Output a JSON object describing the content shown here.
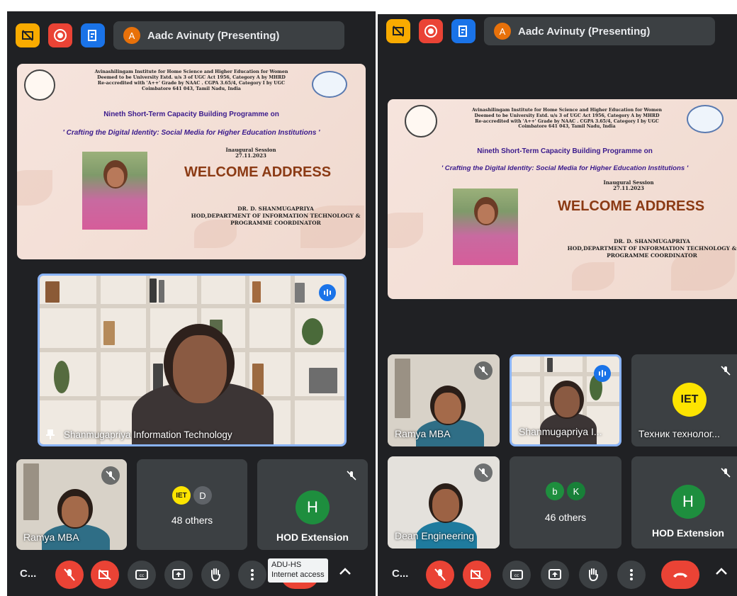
{
  "presenter": {
    "initial": "A",
    "name": "Aadc Avinuty (Presenting)"
  },
  "slide": {
    "institution": [
      "Avinashilingam Institute for Home Science and Higher Education for Women",
      "Deemed to be University Estd. u/s 3 of UGC Act 1956, Category A by MHRD",
      "Re-accredited with 'A++' Grade by NAAC . CGPA 3.65/4, Category I by UGC",
      "Coimbatore 641 043, Tamil Nadu, India"
    ],
    "programme": "Nineth Short-Term Capacity Building Programme on",
    "theme": "' Crafting the Digital Identity: Social Media for Higher Education Institutions '",
    "session_label": "Inaugural Session",
    "session_date": "27.11.2023",
    "heading": "WELCOME ADDRESS",
    "speaker_name": "DR. D. SHANMUGAPRIYA",
    "speaker_role_1": "HOD,DEPARTMENT OF INFORMATION TECHNOLOGY &",
    "speaker_role_2": "PROGRAMME COORDINATOR"
  },
  "left": {
    "pinned_name": "Shanmugapriya Information Technology",
    "tile_ramya": "Ramya MBA",
    "others_avatar_initial": "D",
    "others_logo": "IET",
    "others_count": "48 others",
    "hod_initial": "H",
    "hod_name": "HOD Extension",
    "call_label": "C...",
    "tooltip_line1": "ADU-HS",
    "tooltip_line2": "Internet access"
  },
  "right": {
    "tile_ramya": "Ramya MBA",
    "tile_shan": "Shanmugapriya I...",
    "tile_tech": "Техник технолог...",
    "tech_logo": "IET",
    "tile_dean": "Dean Engineering",
    "others_av1": "b",
    "others_av2": "K",
    "others_count": "46 others",
    "hod_initial": "H",
    "hod_name": "HOD Extension",
    "call_label": "C..."
  },
  "colors": {
    "background": "#202124",
    "tile": "#3c4043",
    "accent_blue": "#1a73e8",
    "mic_red": "#ea4335",
    "avatar_orange": "#e8710a",
    "avatar_green": "#1e8e3e",
    "iet_yellow": "#fde400"
  }
}
